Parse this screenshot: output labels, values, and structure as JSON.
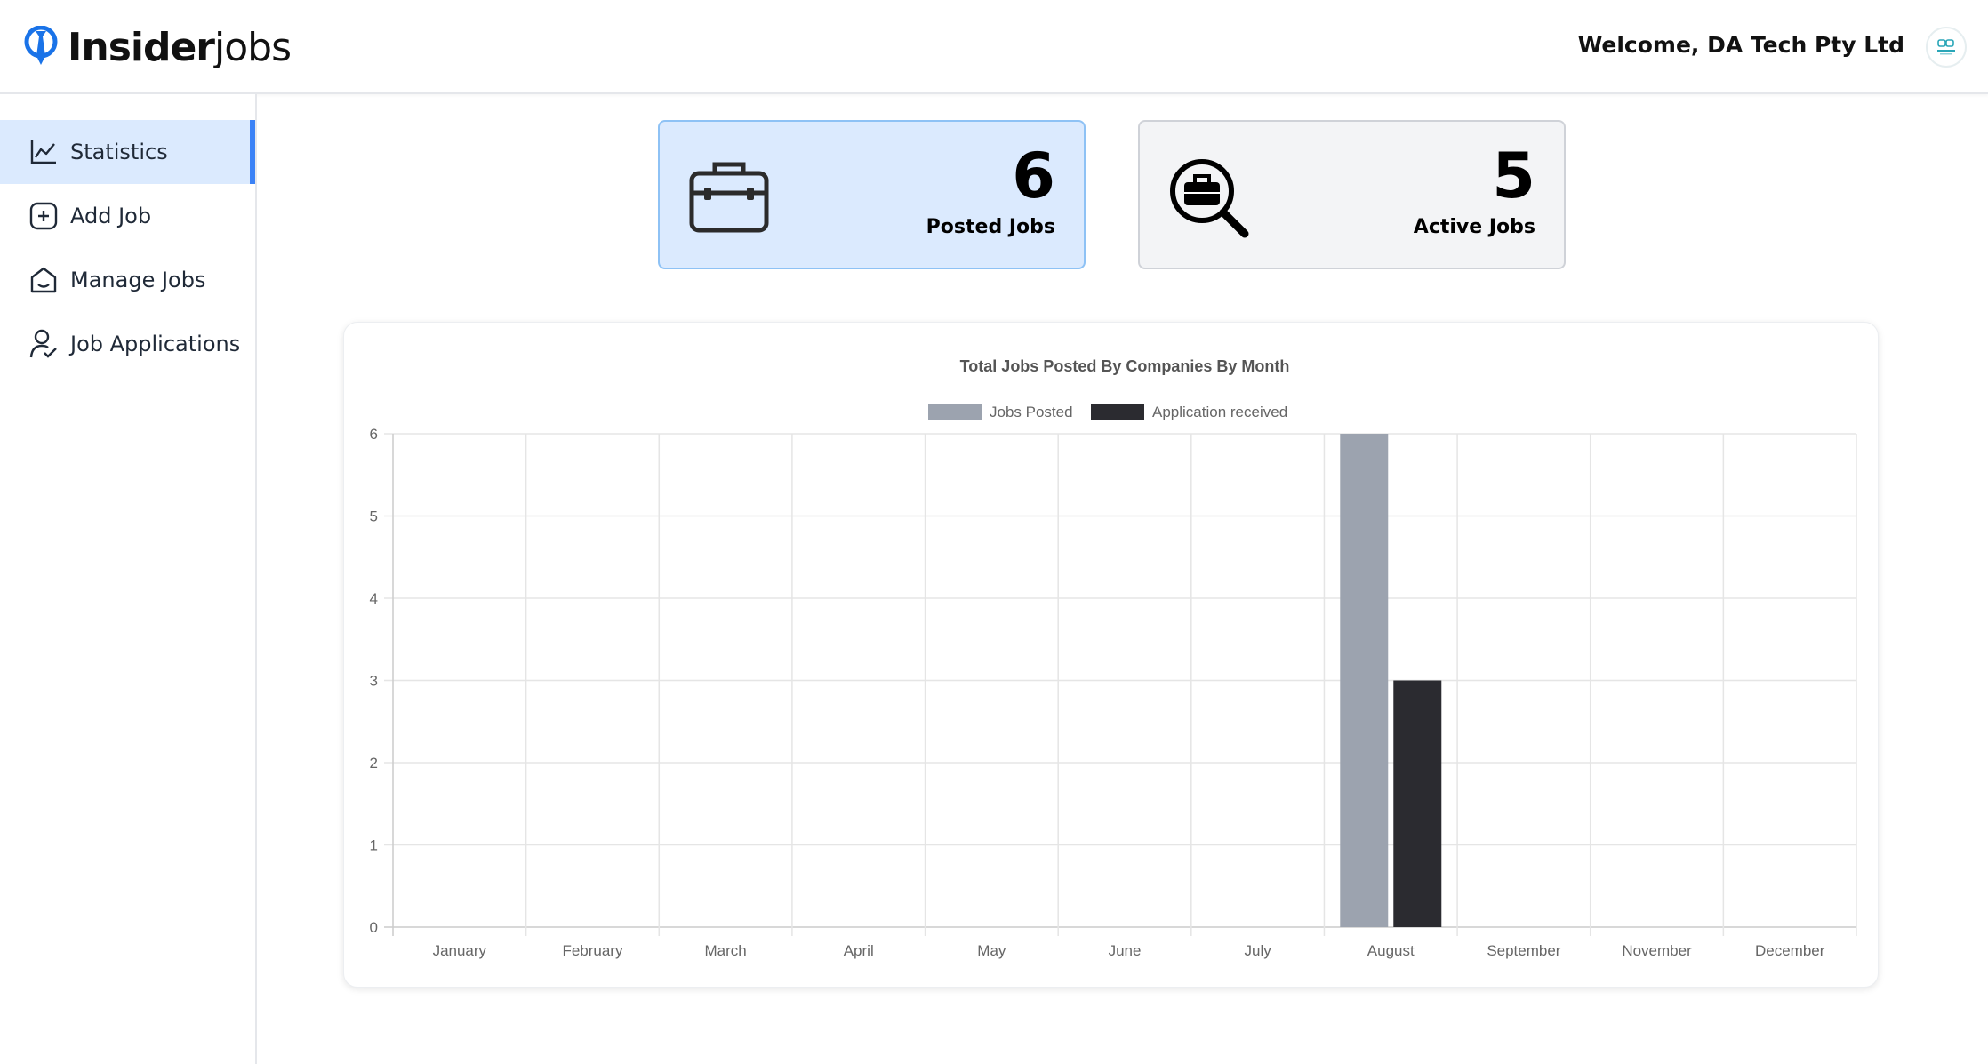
{
  "header": {
    "logo_bold": "Insider",
    "logo_light": "jobs",
    "welcome": "Welcome, DA Tech Pty Ltd",
    "brand_color": "#1a73e8"
  },
  "sidebar": {
    "items": [
      {
        "label": "Statistics",
        "icon": "chart-line-icon",
        "active": true
      },
      {
        "label": "Add Job",
        "icon": "plus-square-icon",
        "active": false
      },
      {
        "label": "Manage Jobs",
        "icon": "home-icon",
        "active": false
      },
      {
        "label": "Job Applications",
        "icon": "user-check-icon",
        "active": false
      }
    ]
  },
  "stats": {
    "posted": {
      "value": "6",
      "label": "Posted Jobs",
      "icon": "briefcase-icon"
    },
    "active": {
      "value": "5",
      "label": "Active Jobs",
      "icon": "search-briefcase-icon"
    }
  },
  "chart_data": {
    "type": "bar",
    "title": "Total Jobs Posted By Companies By Month",
    "categories": [
      "January",
      "February",
      "March",
      "April",
      "May",
      "June",
      "July",
      "August",
      "September",
      "November",
      "December"
    ],
    "series": [
      {
        "name": "Jobs Posted",
        "color": "#9ca3af",
        "values": [
          0,
          0,
          0,
          0,
          0,
          0,
          0,
          6,
          0,
          0,
          0
        ]
      },
      {
        "name": "Application received",
        "color": "#2b2b30",
        "values": [
          0,
          0,
          0,
          0,
          0,
          0,
          0,
          3,
          0,
          0,
          0
        ]
      }
    ],
    "ylim": [
      0,
      6
    ],
    "yticks": [
      0,
      1,
      2,
      3,
      4,
      5,
      6
    ],
    "legend": "top",
    "grid": true
  }
}
